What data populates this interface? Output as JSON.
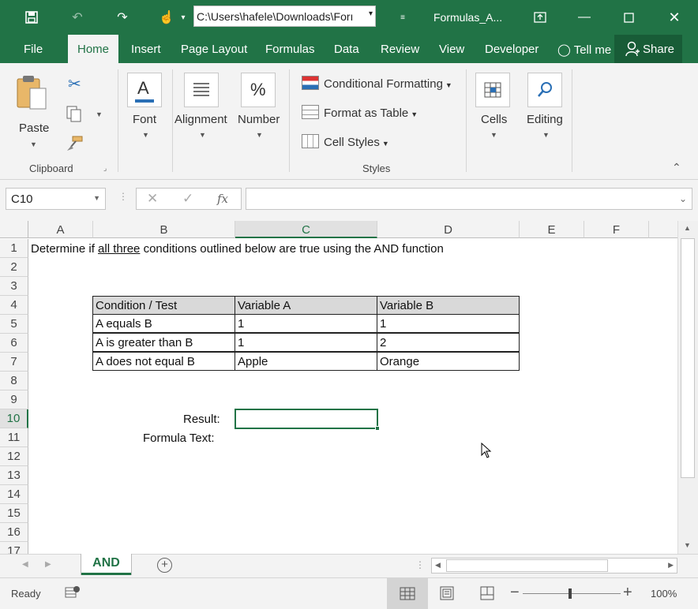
{
  "titlebar": {
    "path": "C:\\Users\\hafele\\Downloads\\Forı",
    "title": "Formulas_A..."
  },
  "tabs": [
    "File",
    "Home",
    "Insert",
    "Page Layout",
    "Formulas",
    "Data",
    "Review",
    "View",
    "Developer"
  ],
  "tell_me": "Tell me",
  "share": "Share",
  "ribbon": {
    "paste": "Paste",
    "clipboard": "Clipboard",
    "font": "Font",
    "alignment": "Alignment",
    "number": "Number",
    "conditional_formatting": "Conditional Formatting",
    "format_as_table": "Format as Table",
    "cell_styles": "Cell Styles",
    "styles": "Styles",
    "cells": "Cells",
    "editing": "Editing"
  },
  "formula_bar": {
    "name_box": "C10",
    "fx": "fx",
    "content": ""
  },
  "columns": [
    "A",
    "B",
    "C",
    "D",
    "E",
    "F"
  ],
  "rows": [
    "1",
    "2",
    "3",
    "4",
    "5",
    "6",
    "7",
    "8",
    "9",
    "10",
    "11",
    "12",
    "13",
    "14",
    "15",
    "16",
    "17"
  ],
  "sheet": {
    "intro_pre": "Determine if ",
    "intro_underlined": "all three",
    "intro_post": " conditions outlined below are true using the AND function",
    "table_headers": [
      "Condition / Test",
      "Variable A",
      "Variable B"
    ],
    "table_rows": [
      [
        "A equals B",
        "1",
        "1"
      ],
      [
        "A is greater than B",
        "1",
        "2"
      ],
      [
        "A does not equal B",
        "Apple",
        "Orange"
      ]
    ],
    "result_label": "Result:",
    "formula_text_label": "Formula Text:"
  },
  "sheet_tab": "AND",
  "status": {
    "ready": "Ready",
    "zoom": "100%",
    "zoom_level": 100
  },
  "colors": {
    "brand": "#217346",
    "header_fill": "#d9d9d9"
  }
}
